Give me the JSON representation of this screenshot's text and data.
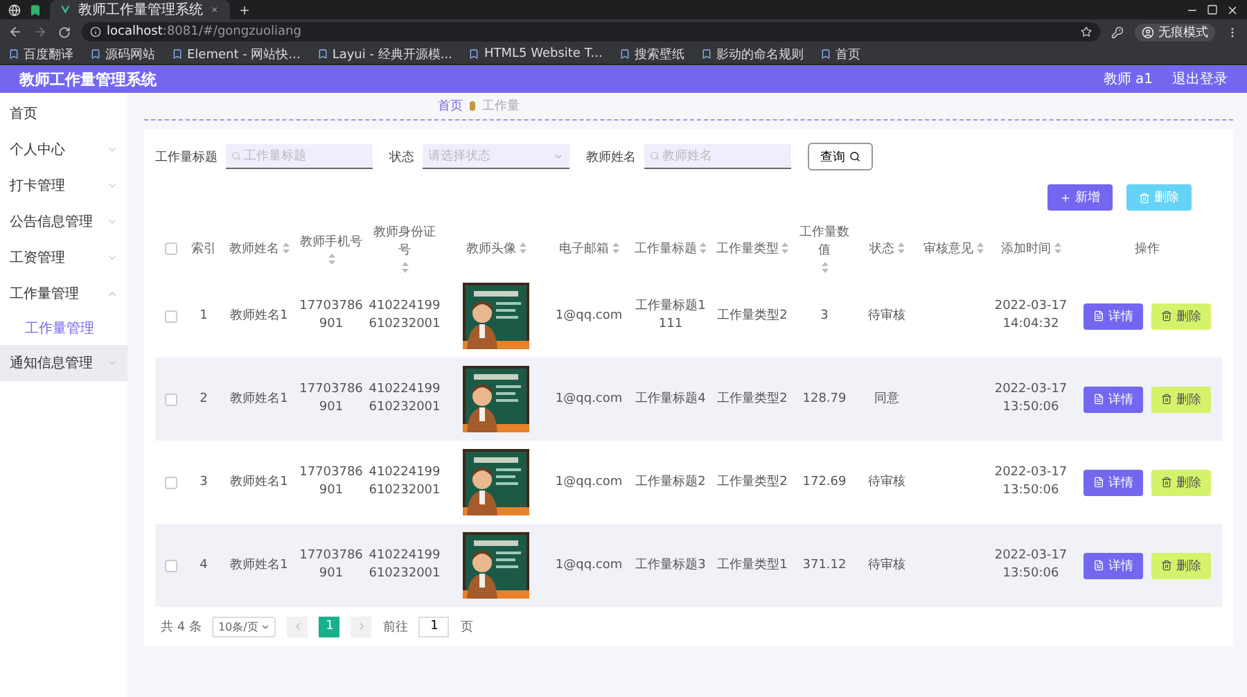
{
  "browser": {
    "tab_title": "教师工作量管理系统",
    "url_host": "localhost",
    "url_rest": ":8081/#/gongzuoliang",
    "profile": "无痕模式",
    "bookmarks": [
      "百度翻译",
      "源码网站",
      "Element - 网站快...",
      "Layui - 经典开源模...",
      "HTML5 Website T...",
      "搜索壁纸",
      "影动的命名规则",
      "首页"
    ]
  },
  "header": {
    "title": "教师工作量管理系统",
    "user": "教师 a1",
    "logout": "退出登录"
  },
  "sidebar": {
    "items": [
      {
        "label": "首页",
        "kind": "link",
        "highlighted": false
      },
      {
        "label": "个人中心",
        "kind": "submenu",
        "expanded": false,
        "highlighted": false
      },
      {
        "label": "打卡管理",
        "kind": "submenu",
        "expanded": false,
        "highlighted": false
      },
      {
        "label": "公告信息管理",
        "kind": "submenu",
        "expanded": false,
        "highlighted": false
      },
      {
        "label": "工资管理",
        "kind": "submenu",
        "expanded": false,
        "highlighted": false
      },
      {
        "label": "工作量管理",
        "kind": "submenu",
        "expanded": true,
        "highlighted": false,
        "children": [
          {
            "label": "工作量管理",
            "selected": true
          }
        ]
      },
      {
        "label": "通知信息管理",
        "kind": "submenu",
        "expanded": false,
        "highlighted": true
      }
    ]
  },
  "breadcrumb": [
    "首页",
    "工作量"
  ],
  "search": {
    "fields": [
      {
        "label": "工作量标题",
        "kind": "input",
        "placeholder": "工作量标题"
      },
      {
        "label": "状态",
        "kind": "select",
        "placeholder": "请选择状态"
      },
      {
        "label": "教师姓名",
        "kind": "input",
        "placeholder": "教师姓名"
      }
    ],
    "button": "查询"
  },
  "actions": [
    {
      "kind": "add",
      "label": "新增"
    },
    {
      "kind": "delete",
      "label": "删除"
    }
  ],
  "table": {
    "select_all": {
      "checked": false
    },
    "columns": [
      {
        "label": "索引",
        "sortable": false
      },
      {
        "label": "教师姓名",
        "sortable": true
      },
      {
        "label": "教师手机号",
        "sortable": true
      },
      {
        "label": "教师身份证号",
        "sortable": true
      },
      {
        "label": "教师头像",
        "sortable": true
      },
      {
        "label": "电子邮箱",
        "sortable": true
      },
      {
        "label": "工作量标题",
        "sortable": true
      },
      {
        "label": "工作量类型",
        "sortable": true
      },
      {
        "label": "工作量数值",
        "sortable": true
      },
      {
        "label": "状态",
        "sortable": true
      },
      {
        "label": "审核意见",
        "sortable": true
      },
      {
        "label": "添加时间",
        "sortable": true
      },
      {
        "label": "操作",
        "sortable": false
      }
    ],
    "rows": [
      {
        "checked": false,
        "index": "1",
        "name": "教师姓名1",
        "phone": "17703786901",
        "id_number": "410224199610232001",
        "avatar": {
          "kind": "picture"
        },
        "email": "1@qq.com",
        "title": "工作量标题1111",
        "type": "工作量类型2",
        "value": "3",
        "status": "待审核",
        "time": "2022-03-17 14:04:32",
        "actions": [
          {
            "kind": "detail",
            "label": "详情"
          },
          {
            "kind": "delete",
            "label": "删除"
          }
        ]
      },
      {
        "checked": false,
        "index": "2",
        "name": "教师姓名1",
        "phone": "17703786901",
        "id_number": "410224199610232001",
        "avatar": {
          "kind": "picture"
        },
        "email": "1@qq.com",
        "title": "工作量标题4",
        "type": "工作量类型2",
        "value": "128.79",
        "status": "同意",
        "time": "2022-03-17 13:50:06",
        "actions": [
          {
            "kind": "detail",
            "label": "详情"
          },
          {
            "kind": "delete",
            "label": "删除"
          }
        ]
      },
      {
        "checked": false,
        "index": "3",
        "name": "教师姓名1",
        "phone": "17703786901",
        "id_number": "410224199610232001",
        "avatar": {
          "kind": "picture"
        },
        "email": "1@qq.com",
        "title": "工作量标题2",
        "type": "工作量类型2",
        "value": "172.69",
        "status": "待审核",
        "time": "2022-03-17 13:50:06",
        "actions": [
          {
            "kind": "detail",
            "label": "详情"
          },
          {
            "kind": "delete",
            "label": "删除"
          }
        ]
      },
      {
        "checked": false,
        "index": "4",
        "name": "教师姓名1",
        "phone": "17703786901",
        "id_number": "410224199610232001",
        "avatar": {
          "kind": "picture"
        },
        "email": "1@qq.com",
        "title": "工作量标题3",
        "type": "工作量类型1",
        "value": "371.12",
        "status": "待审核",
        "time": "2022-03-17 13:50:06",
        "actions": [
          {
            "kind": "detail",
            "label": "详情"
          },
          {
            "kind": "delete",
            "label": "删除"
          }
        ]
      }
    ]
  },
  "pagination": {
    "total": "共 4 条",
    "page_size": "10条/页",
    "pages": [
      {
        "label": "1",
        "selected": true
      }
    ],
    "goto_label": "前往",
    "goto_value": "1",
    "goto_suffix": "页"
  }
}
